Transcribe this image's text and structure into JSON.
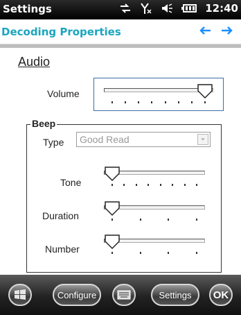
{
  "status": {
    "title": "Settings",
    "time": "12:40",
    "icons": [
      "sync-icon",
      "no-signal-icon",
      "volume-icon",
      "battery-icon"
    ]
  },
  "header": {
    "title": "Decoding Properties",
    "nav_icons": [
      "back-arrow-icon",
      "forward-arrow-icon"
    ]
  },
  "audio": {
    "heading": "Audio",
    "volume_label": "Volume",
    "volume_level": 1.0
  },
  "beep": {
    "legend": "Beep",
    "type_label": "Type",
    "type_value": "Good Read",
    "tone_label": "Tone",
    "tone_level": 0.0,
    "duration_label": "Duration",
    "duration_level": 0.0,
    "number_label": "Number",
    "number_level": 0.0
  },
  "toolbar": {
    "start_icon": "windows-start-icon",
    "configure_label": "Configure",
    "keyboard_icon": "keyboard-icon",
    "settings_label": "Settings",
    "ok_label": "OK"
  },
  "colors": {
    "accent": "#1aa5bf",
    "nav_arrow": "#1e90ff",
    "focus_border": "#3b6ea5"
  }
}
